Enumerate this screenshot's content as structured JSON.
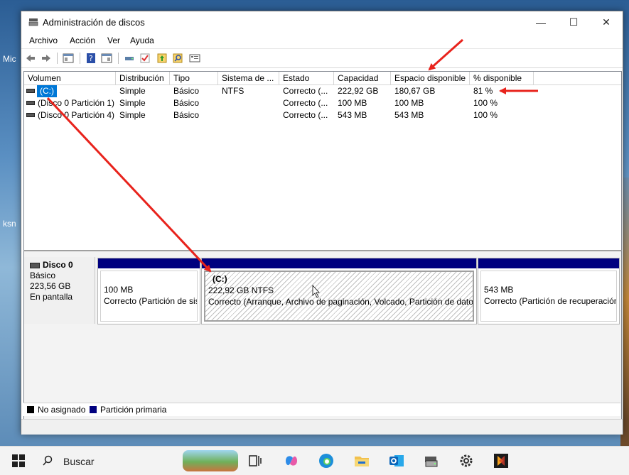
{
  "window": {
    "title": "Administración de discos",
    "controls": {
      "minimize": "—",
      "maximize": "☐",
      "close": "✕"
    }
  },
  "menu": [
    "Archivo",
    "Acción",
    "Ver",
    "Ayuda"
  ],
  "toolbar": [
    "back-icon",
    "forward-icon",
    "console-icon",
    "help-icon",
    "properties-icon",
    "connect-icon",
    "check-icon",
    "import-icon",
    "search-icon",
    "list-icon"
  ],
  "desktop": {
    "labels": [
      "Mic",
      "ksn"
    ]
  },
  "volumes": {
    "columns": [
      "Volumen",
      "Distribución",
      "Tipo",
      "Sistema de ...",
      "Estado",
      "Capacidad",
      "Espacio disponible",
      "% disponible"
    ],
    "rows": [
      {
        "volume": "(C:)",
        "layout": "Simple",
        "type": "Básico",
        "fs": "NTFS",
        "status": "Correcto (...",
        "capacity": "222,92 GB",
        "free": "180,67 GB",
        "pct": "81 %"
      },
      {
        "volume": "(Disco 0 Partición 1)",
        "layout": "Simple",
        "type": "Básico",
        "fs": "",
        "status": "Correcto (...",
        "capacity": "100 MB",
        "free": "100 MB",
        "pct": "100 %"
      },
      {
        "volume": "(Disco 0 Partición 4)",
        "layout": "Simple",
        "type": "Básico",
        "fs": "",
        "status": "Correcto (...",
        "capacity": "543 MB",
        "free": "543 MB",
        "pct": "100 %"
      }
    ]
  },
  "disk": {
    "name": "Disco 0",
    "type": "Básico",
    "size": "223,56 GB",
    "state": "En pantalla",
    "partitions": [
      {
        "label": "",
        "size": "100 MB",
        "status": "Correcto (Partición de sistema EFI)"
      },
      {
        "label": "(C:)",
        "size": "222,92 GB NTFS",
        "status": "Correcto (Arranque, Archivo de paginación, Volcado, Partición de datos básicos)"
      },
      {
        "label": "",
        "size": "543 MB",
        "status": "Correcto (Partición de recuperación)"
      }
    ]
  },
  "legend": [
    {
      "label": "No asignado",
      "color": "#000000"
    },
    {
      "label": "Partición primaria",
      "color": "#00007f"
    }
  ],
  "taskbar": {
    "search_label": "Buscar",
    "icons": [
      "windows-start-icon",
      "task-view-icon",
      "copilot-icon",
      "edge-icon",
      "file-explorer-icon",
      "outlook-icon",
      "disk-management-icon",
      "settings-icon",
      "app-icon"
    ]
  },
  "accent": "#0078d7",
  "annotation_color": "#e8231c"
}
